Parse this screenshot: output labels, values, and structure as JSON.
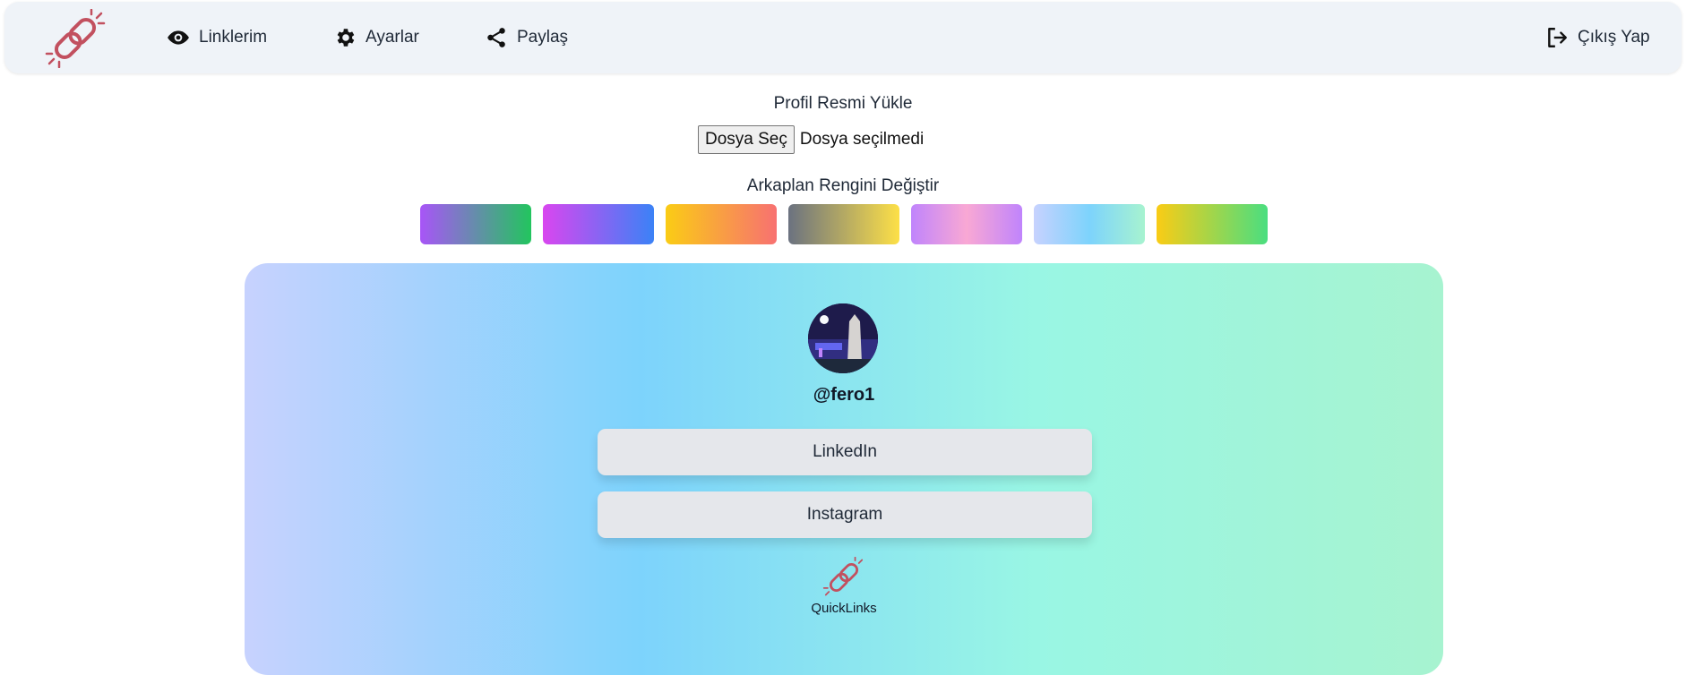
{
  "nav": {
    "logo_icon": "chain-link-icon",
    "items": [
      {
        "label": "Linklerim",
        "icon": "eye-icon"
      },
      {
        "label": "Ayarlar",
        "icon": "gear-icon"
      },
      {
        "label": "Paylaş",
        "icon": "share-icon"
      }
    ],
    "logout": {
      "label": "Çıkış Yap",
      "icon": "logout-icon"
    }
  },
  "upload": {
    "title": "Profil Resmi Yükle",
    "button_label": "Dosya Seç",
    "status": "Dosya seçilmedi"
  },
  "background": {
    "title": "Arkaplan Rengini Değiştir",
    "swatches": [
      {
        "from": "#a855f7",
        "to": "#22c55e"
      },
      {
        "from": "#d946ef",
        "to": "#3b82f6"
      },
      {
        "from": "#facc15",
        "to": "#f87171"
      },
      {
        "from": "#6b7280",
        "to": "#fde047"
      },
      {
        "from": "#c084fc",
        "via": "#f9a8d4",
        "to": "#c084fc"
      },
      {
        "from": "#c7d2fe",
        "via": "#7dd3fc",
        "to": "#a7f3d0"
      },
      {
        "from": "#facc15",
        "to": "#4ade80"
      }
    ]
  },
  "profile": {
    "username": "@fero1",
    "links": [
      {
        "label": "LinkedIn"
      },
      {
        "label": "Instagram"
      }
    ],
    "brand": "QuickLinks"
  },
  "colors": {
    "nav_bg": "#eff3f8",
    "logo_red": "#c2505f",
    "link_button_bg": "#e5e7eb"
  }
}
